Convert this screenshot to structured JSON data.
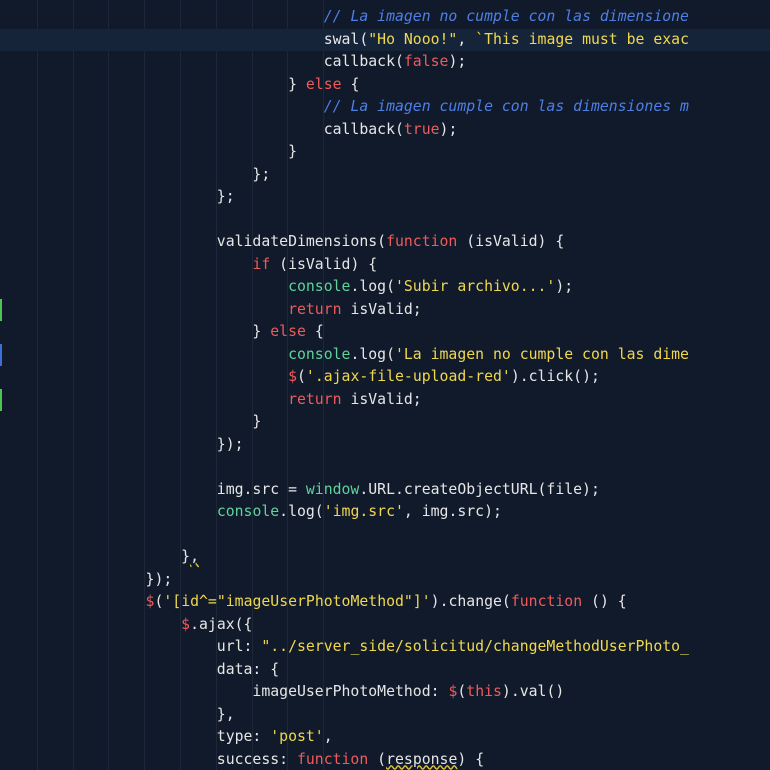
{
  "colors": {
    "background": "#101a2b",
    "plain": "#e6e6e6",
    "keyword": "#ef5b5b",
    "string": "#f0d84d",
    "comment": "#4f7fe4",
    "builtin": "#5fd39a"
  },
  "lines": [
    [
      {
        "t": "                                    "
      },
      {
        "t": "// La imagen no cumple con las dimensione",
        "c": "comment"
      }
    ],
    [
      {
        "t": "                                    swal("
      },
      {
        "t": "\"Ho Nooo!\"",
        "c": "string"
      },
      {
        "t": ", "
      },
      {
        "t": "`This image must be exac",
        "c": "string"
      }
    ],
    [
      {
        "t": "                                    callback("
      },
      {
        "t": "false",
        "c": "keyword"
      },
      {
        "t": ");"
      }
    ],
    [
      {
        "t": "                                } "
      },
      {
        "t": "else",
        "c": "keyword"
      },
      {
        "t": " {"
      }
    ],
    [
      {
        "t": "                                    "
      },
      {
        "t": "// La imagen cumple con las dimensiones m",
        "c": "comment"
      }
    ],
    [
      {
        "t": "                                    callback("
      },
      {
        "t": "true",
        "c": "keyword"
      },
      {
        "t": ");"
      }
    ],
    [
      {
        "t": "                                }"
      }
    ],
    [
      {
        "t": "                            };"
      }
    ],
    [
      {
        "t": "                        };"
      }
    ],
    [
      {
        "t": ""
      }
    ],
    [
      {
        "t": "                        validateDimensions("
      },
      {
        "t": "function",
        "c": "keyword"
      },
      {
        "t": " (isValid) {"
      }
    ],
    [
      {
        "t": "                            "
      },
      {
        "t": "if",
        "c": "keyword"
      },
      {
        "t": " (isValid) {"
      }
    ],
    [
      {
        "t": "                                "
      },
      {
        "t": "console",
        "c": "builtin"
      },
      {
        "t": ".log("
      },
      {
        "t": "'Subir archivo...'",
        "c": "string"
      },
      {
        "t": ");"
      }
    ],
    [
      {
        "t": "                                "
      },
      {
        "t": "return",
        "c": "keyword"
      },
      {
        "t": " isValid;"
      }
    ],
    [
      {
        "t": "                            } "
      },
      {
        "t": "else",
        "c": "keyword"
      },
      {
        "t": " {"
      }
    ],
    [
      {
        "t": "                                "
      },
      {
        "t": "console",
        "c": "builtin"
      },
      {
        "t": ".log("
      },
      {
        "t": "'La imagen no cumple con las dime",
        "c": "string"
      }
    ],
    [
      {
        "t": "                                "
      },
      {
        "t": "$",
        "c": "keyword"
      },
      {
        "t": "("
      },
      {
        "t": "'.ajax-file-upload-red'",
        "c": "string"
      },
      {
        "t": ").click();"
      }
    ],
    [
      {
        "t": "                                "
      },
      {
        "t": "return",
        "c": "keyword"
      },
      {
        "t": " isValid;"
      }
    ],
    [
      {
        "t": "                            }"
      }
    ],
    [
      {
        "t": "                        });"
      }
    ],
    [
      {
        "t": ""
      }
    ],
    [
      {
        "t": "                        img.src = "
      },
      {
        "t": "window",
        "c": "builtin"
      },
      {
        "t": ".URL.createObjectURL(file);"
      }
    ],
    [
      {
        "t": "                        "
      },
      {
        "t": "console",
        "c": "builtin"
      },
      {
        "t": ".log("
      },
      {
        "t": "'img.src'",
        "c": "string"
      },
      {
        "t": ", img.src);"
      }
    ],
    [
      {
        "t": ""
      }
    ],
    [
      {
        "t": "                    }"
      },
      {
        "t": ",",
        "c": "squiggle"
      }
    ],
    [
      {
        "t": "                });"
      }
    ],
    [
      {
        "t": "                "
      },
      {
        "t": "$",
        "c": "keyword"
      },
      {
        "t": "("
      },
      {
        "t": "'[id^=\"imageUserPhotoMethod\"]'",
        "c": "string"
      },
      {
        "t": ").change("
      },
      {
        "t": "function",
        "c": "keyword"
      },
      {
        "t": " () {"
      }
    ],
    [
      {
        "t": "                    "
      },
      {
        "t": "$",
        "c": "keyword"
      },
      {
        "t": ".ajax({"
      }
    ],
    [
      {
        "t": "                        url: "
      },
      {
        "t": "\"../server_side/solicitud/changeMethodUserPhoto_",
        "c": "string"
      }
    ],
    [
      {
        "t": "                        data: {"
      }
    ],
    [
      {
        "t": "                            imageUserPhotoMethod: "
      },
      {
        "t": "$",
        "c": "keyword"
      },
      {
        "t": "("
      },
      {
        "t": "this",
        "c": "keyword"
      },
      {
        "t": ").val()"
      }
    ],
    [
      {
        "t": "                        },"
      }
    ],
    [
      {
        "t": "                        type: "
      },
      {
        "t": "'post'",
        "c": "string"
      },
      {
        "t": ","
      }
    ],
    [
      {
        "t": "                        success: "
      },
      {
        "t": "function",
        "c": "keyword"
      },
      {
        "t": " ("
      },
      {
        "t": "response",
        "c": "squiggle"
      },
      {
        "t": ") {"
      }
    ]
  ]
}
